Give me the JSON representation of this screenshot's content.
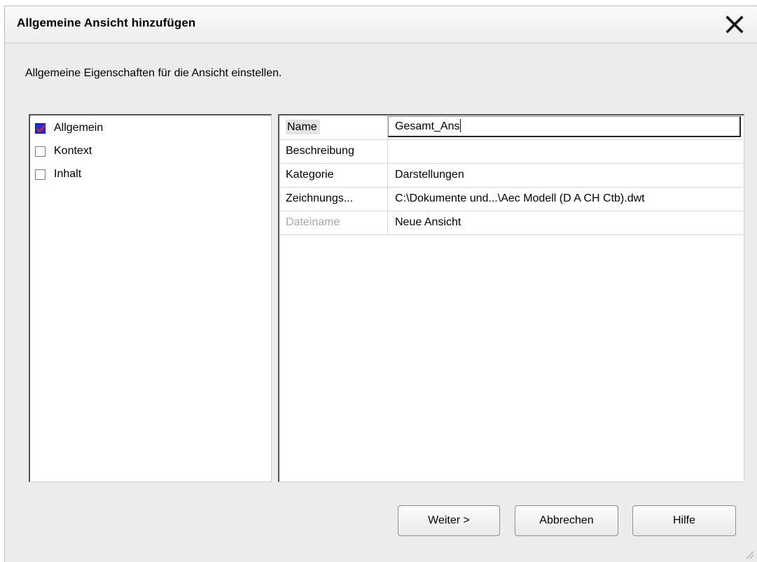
{
  "dialog": {
    "title": "Allgemeine Ansicht hinzufügen",
    "intro": "Allgemeine Eigenschaften für die Ansicht einstellen."
  },
  "tree": {
    "items": [
      {
        "label": "Allgemein",
        "checked": true
      },
      {
        "label": "Kontext",
        "checked": false
      },
      {
        "label": "Inhalt",
        "checked": false
      }
    ]
  },
  "properties": {
    "rows": [
      {
        "label": "Name",
        "value": "Gesamt_Ans"
      },
      {
        "label": "Beschreibung",
        "value": ""
      },
      {
        "label": "Kategorie",
        "value": "Darstellungen"
      },
      {
        "label": "Zeichnungs...",
        "value": "C:\\Dokumente und...\\Aec Modell (D A CH Ctb).dwt"
      },
      {
        "label": "Dateiname",
        "value": "Neue Ansicht"
      }
    ]
  },
  "buttons": {
    "next": "Weiter >",
    "cancel": "Abbrechen",
    "help": "Hilfe"
  },
  "icons": {
    "close": "close-icon",
    "check": "checkmark-icon",
    "resize": "resize-grip-icon"
  },
  "colors": {
    "checkbox_checked": "#1e2dd6",
    "checkmark": "#e0202a"
  }
}
